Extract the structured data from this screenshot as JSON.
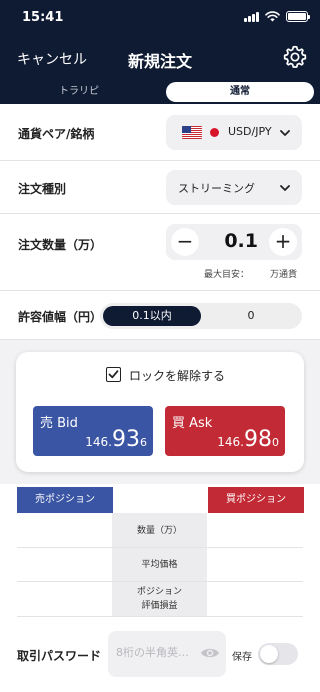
{
  "status_bar": {
    "time": "15:41"
  },
  "nav": {
    "cancel_label": "キャンセル",
    "title": "新規注文",
    "settings_icon": "gear-icon"
  },
  "segmented": {
    "tabs": [
      {
        "label": "トラリピ",
        "selected": false
      },
      {
        "label": "通常",
        "selected": true
      }
    ]
  },
  "form": {
    "pair": {
      "label": "通貨ペア/銘柄",
      "value": "USD/JPY",
      "icons": [
        "us-flag-icon",
        "jp-flag-icon"
      ]
    },
    "order_type": {
      "label": "注文種別",
      "value": "ストリーミング"
    },
    "quantity": {
      "label": "注文数量（万）",
      "value": "0.1",
      "hint_label": "最大目安：",
      "hint_value": "万通貨"
    },
    "tolerance": {
      "label": "許容値幅（円）",
      "options": [
        {
          "label": "0.1以内",
          "selected": true
        },
        {
          "label": "0",
          "selected": false
        }
      ]
    }
  },
  "rate_card": {
    "lock_label": "ロックを解除する",
    "lock_checked": true,
    "bid": {
      "label": "売 Bid",
      "price_big": "146.",
      "price_main": "93",
      "price_tail": "6"
    },
    "ask": {
      "label": "買 Ask",
      "price_big": "146.",
      "price_main": "98",
      "price_tail": "0"
    }
  },
  "positions": {
    "sell_tab": "売ポジション",
    "buy_tab": "買ポジション",
    "columns": {
      "quantity": "数量（万）",
      "avg_price": "平均価格",
      "pl_line1": "ポジション",
      "pl_line2": "評価損益"
    }
  },
  "password": {
    "label": "取引パスワード",
    "placeholder": "8桁の半角英…",
    "save_label": "保存",
    "save_enabled": false
  },
  "colors": {
    "navy": "#0f1a33",
    "bid_blue": "#3b55a5",
    "ask_red": "#c22b35"
  }
}
